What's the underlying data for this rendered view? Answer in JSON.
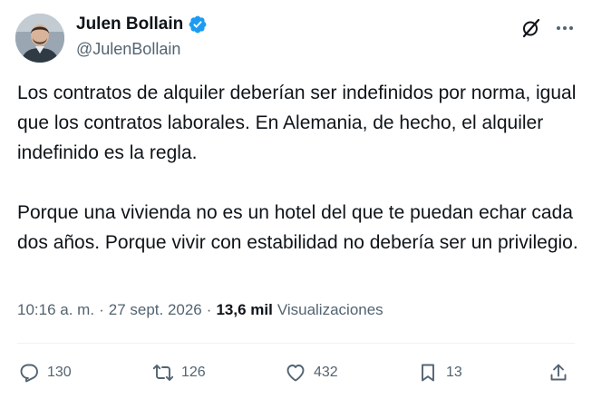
{
  "author": {
    "display_name": "Julen Bollain",
    "handle": "@JulenBollain",
    "verified_color": "#1d9bf0"
  },
  "header_icons": [
    "grok-icon",
    "more-icon"
  ],
  "tweet": {
    "paragraphs": [
      "Los contratos de alquiler deberían ser indefinidos por norma, igual que los contratos laborales. En Alemania, de hecho, el alquiler indefinido es la regla.",
      "Porque una vivienda no es un hotel del que te puedan echar cada dos años. Porque vivir con estabilidad no debería ser un privilegio."
    ]
  },
  "meta": {
    "time": "10:16 a. m.",
    "separator": "·",
    "date": "27 sept. 2026",
    "views_count": "13,6 mil",
    "views_label": "Visualizaciones"
  },
  "actions": {
    "replies": "130",
    "reposts": "126",
    "likes": "432",
    "bookmarks": "13"
  },
  "colors": {
    "text": "#0f1419",
    "secondary": "#536471",
    "divider": "#eff3f4"
  }
}
